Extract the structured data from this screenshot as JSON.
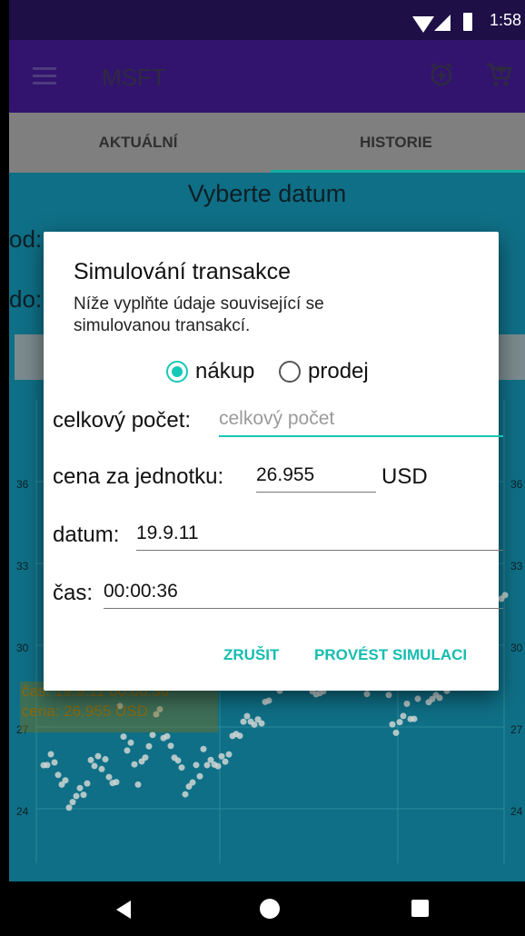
{
  "status_bar": {
    "time": "1:58"
  },
  "app_bar": {
    "title": "MSFT",
    "icons": [
      "menu-icon",
      "alarm-add-icon",
      "cart-icon"
    ]
  },
  "tabs": [
    {
      "label": "AKTUÁLNÍ"
    },
    {
      "label": "HISTORIE"
    }
  ],
  "history": {
    "title": "Vyberte datum",
    "from_label": "od:",
    "to_label": "do:",
    "tooltip": {
      "time": "čas: 19.9.11 00:00:36",
      "price": "cena: 26.955 USD"
    },
    "y_ticks": [
      "36",
      "33",
      "30",
      "27",
      "24"
    ]
  },
  "chart_data": {
    "type": "scatter",
    "y_ticks": [
      36,
      33,
      30,
      27,
      24
    ],
    "note": "series values partially obscured by dialog"
  },
  "dialog": {
    "title": "Simulování transakce",
    "subtitle": "Níže vyplňte údaje související se simulovanou transakcí.",
    "options": [
      {
        "label": "nákup",
        "selected": true
      },
      {
        "label": "prodej",
        "selected": false
      }
    ],
    "fields": {
      "total_count": {
        "label": "celkový počet:",
        "value": "",
        "placeholder": "celkový počet"
      },
      "unit_price": {
        "label": "cena za jednotku:",
        "value": "26.955",
        "unit": "USD"
      },
      "date": {
        "label": "datum:",
        "value": "19.9.11"
      },
      "time": {
        "label": "čas:",
        "value": "00:00:36"
      }
    },
    "buttons": {
      "cancel": "ZRUŠIT",
      "confirm": "PROVÉST SIMULACI"
    }
  },
  "colors": {
    "accent": "#16c9b7",
    "app_bar": "#32146e",
    "status_bar": "#1e0f46",
    "content_bg": "#0f6f86"
  }
}
